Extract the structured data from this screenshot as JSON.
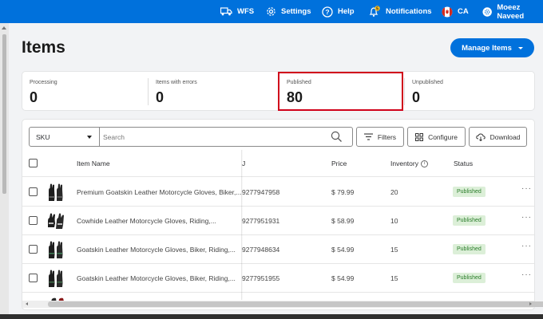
{
  "topbar": {
    "wfs": "WFS",
    "settings": "Settings",
    "help": "Help",
    "notifications": "Notifications",
    "notification_count": "5",
    "country": "CA",
    "user": "Moeez Naveed"
  },
  "header": {
    "title": "Items",
    "manage_button": "Manage Items"
  },
  "stats": [
    {
      "label": "Processing",
      "value": "0"
    },
    {
      "label": "Items with errors",
      "value": "0"
    },
    {
      "label": "Published",
      "value": "80"
    },
    {
      "label": "Unpublished",
      "value": "0"
    }
  ],
  "toolbar": {
    "sku_selected": "SKU",
    "search_placeholder": "Search",
    "filters": "Filters",
    "configure": "Configure",
    "download": "Download"
  },
  "table": {
    "columns": {
      "item_name": "Item Name",
      "id": "J",
      "price": "Price",
      "inventory": "Inventory",
      "status": "Status"
    },
    "rows": [
      {
        "name": "Premium Goatskin Leather Motorcycle Gloves, Biker,...",
        "id": "9277947958",
        "price": "$ 79.99",
        "inventory": "20",
        "status": "Published"
      },
      {
        "name": "Cowhide Leather Motorcycle Gloves, Riding,...",
        "id": "9277951931",
        "price": "$ 58.99",
        "inventory": "10",
        "status": "Published"
      },
      {
        "name": "Goatskin Leather Motorcycle Gloves, Biker, Riding,...",
        "id": "9277948634",
        "price": "$ 54.99",
        "inventory": "15",
        "status": "Published"
      },
      {
        "name": "Goatskin Leather Motorcycle Gloves, Biker, Riding,...",
        "id": "9277951955",
        "price": "$ 54.99",
        "inventory": "15",
        "status": "Published"
      }
    ]
  },
  "colors": {
    "brand_blue": "#0071dc",
    "highlight_red": "#d0021b",
    "published_badge_bg": "#dcefd8",
    "published_badge_text": "#2a7d2a"
  }
}
